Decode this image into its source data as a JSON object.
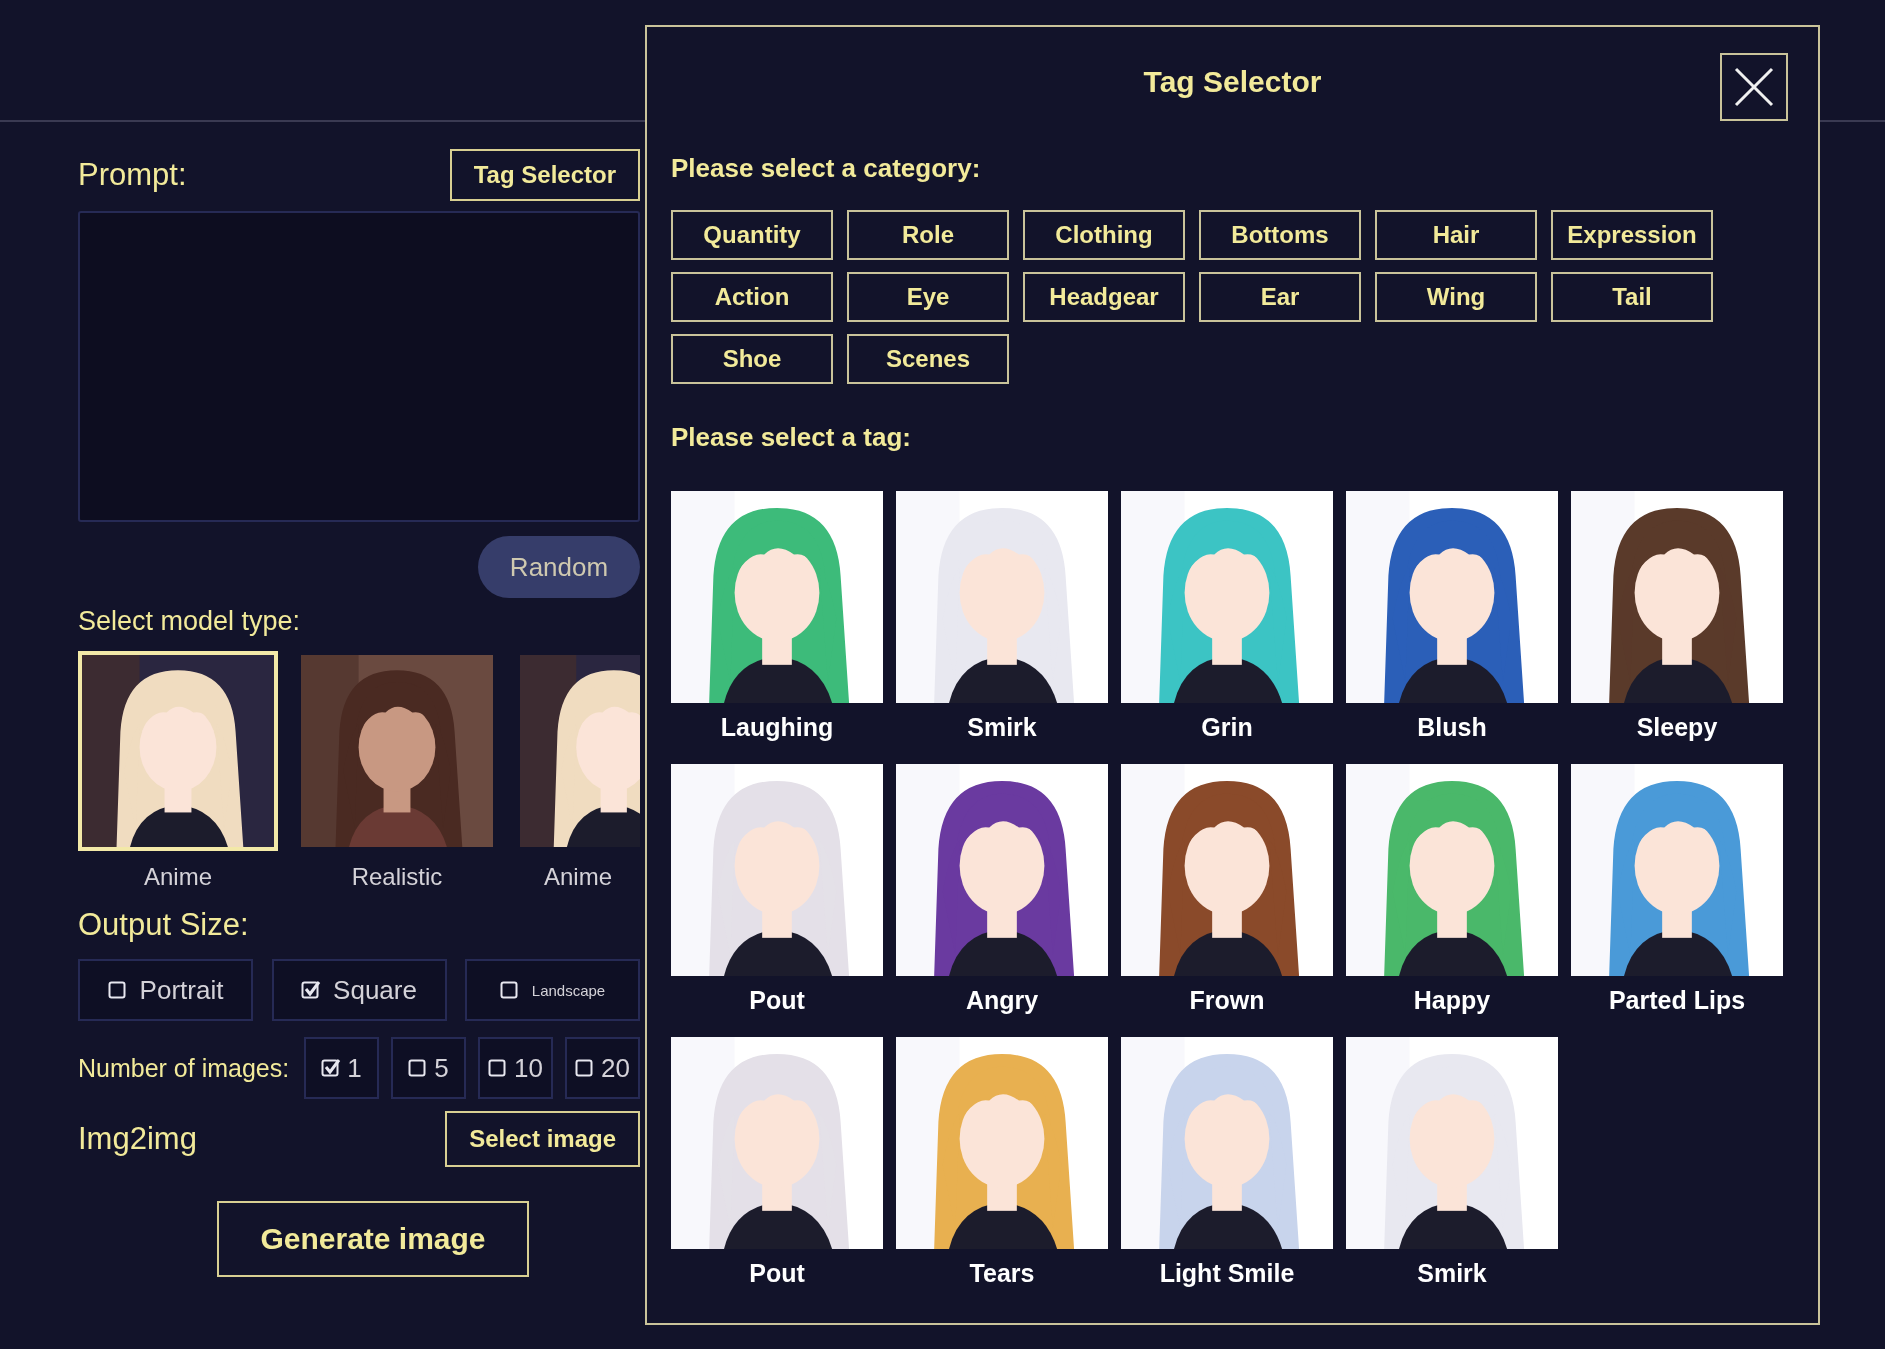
{
  "prompt": {
    "label": "Prompt:",
    "tag_selector_button": "Tag Selector",
    "random_button": "Random"
  },
  "model_type": {
    "label": "Select model type:",
    "models": [
      {
        "name": "Anime",
        "kind": "anime",
        "selected": true
      },
      {
        "name": "Realistic",
        "kind": "realistic",
        "selected": false
      },
      {
        "name": "Anime",
        "kind": "anime",
        "selected": false
      }
    ]
  },
  "output_size": {
    "label": "Output Size:",
    "options": [
      {
        "label": "Portrait",
        "checked": false,
        "small": false
      },
      {
        "label": "Square",
        "checked": true,
        "small": false
      },
      {
        "label": "Landscape",
        "checked": false,
        "small": true
      }
    ]
  },
  "number_of_images": {
    "label": "Number of images:",
    "options": [
      {
        "label": "1",
        "checked": true
      },
      {
        "label": "5",
        "checked": false
      },
      {
        "label": "10",
        "checked": false
      },
      {
        "label": "20",
        "checked": false
      }
    ]
  },
  "img2img": {
    "label": "Img2img",
    "button": "Select image"
  },
  "generate_button": "Generate image",
  "tag_selector": {
    "title": "Tag Selector",
    "category_label": "Please select a category:",
    "categories": [
      "Quantity",
      "Role",
      "Clothing",
      "Bottoms",
      "Hair",
      "Expression",
      "Action",
      "Eye",
      "Headgear",
      "Ear",
      "Wing",
      "Tail",
      "Shoe",
      "Scenes"
    ],
    "tag_label": "Please select a tag:",
    "tags": [
      {
        "label": "Laughing"
      },
      {
        "label": "Smirk"
      },
      {
        "label": "Grin"
      },
      {
        "label": "Blush"
      },
      {
        "label": "Sleepy"
      },
      {
        "label": "Pout"
      },
      {
        "label": "Angry"
      },
      {
        "label": "Frown"
      },
      {
        "label": "Happy"
      },
      {
        "label": "Parted Lips"
      },
      {
        "label": "Pout"
      },
      {
        "label": "Tears"
      },
      {
        "label": "Light Smile"
      },
      {
        "label": "Smirk"
      }
    ]
  }
}
